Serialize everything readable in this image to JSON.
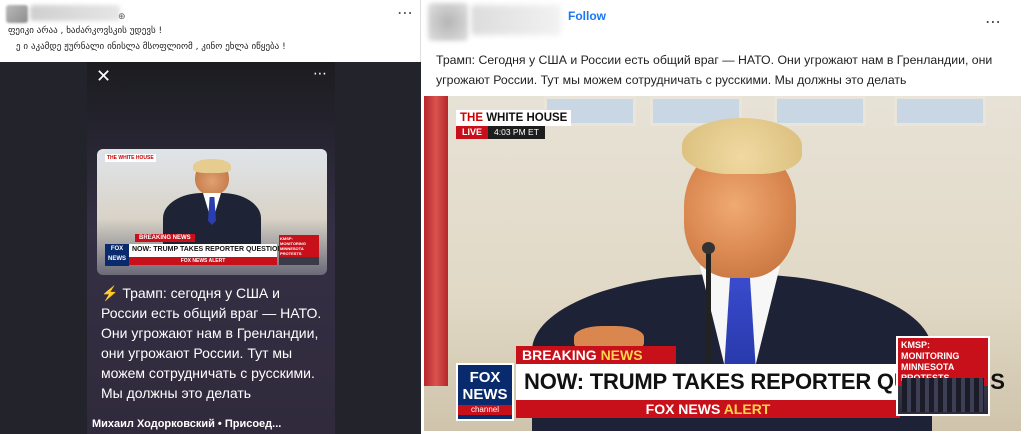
{
  "left_post": {
    "line1": "ფეიკი არაა , ხაძარკოვსკის უდევს !",
    "line2": "ე ი    აკამდე  ჟურნალი ინისლა მსოფლიომ , კინო ეხლა იწყება !",
    "story": {
      "text_bolt": "⚡",
      "text": "Трамп: сегодня у США и России есть общий враг — НАТО. Они угрожают нам в Гренландии, они угрожают России. Тут мы можем сотрудничать с русскими. Мы должны это делать",
      "author": "Михаил Ходорковский • Присоед...",
      "thumb": {
        "whitehouse": "THE WHITE HOUSE",
        "breaking": "BREAKING NEWS",
        "fox": "FOX NEWS",
        "headline": "NOW: TRUMP TAKES REPORTER QUESTIONS",
        "alert": "FOX NEWS ALERT",
        "kmsp": "KMSP: MONITORING MINNESOTA PROTESTS"
      }
    }
  },
  "right_post": {
    "follow_label": "Follow",
    "text": "Трамп: Сегодня у США и России есть общий враг — НАТО. Они угрожают нам в Гренландии, они угрожают России. Тут мы можем сотрудничать с русскими. Мы должны это делать",
    "image": {
      "whitehouse_pre": "THE",
      "whitehouse_main": "WHITE HOUSE",
      "live": "LIVE",
      "time": "4:03 PM ET",
      "breaking_a": "BREAKING",
      "breaking_b": "NEWS",
      "fox_top": "FOX NEWS",
      "fox_bottom": "channel",
      "headline": "NOW: TRUMP TAKES REPORTER QUESTIONS",
      "alert_a": "FOX NEWS",
      "alert_b": "ALERT",
      "kmsp": "KMSP: MONITORING MINNESOTA PROTESTS"
    }
  },
  "icons": {
    "more": "⋯",
    "close": "✕",
    "globe": "⊕"
  }
}
